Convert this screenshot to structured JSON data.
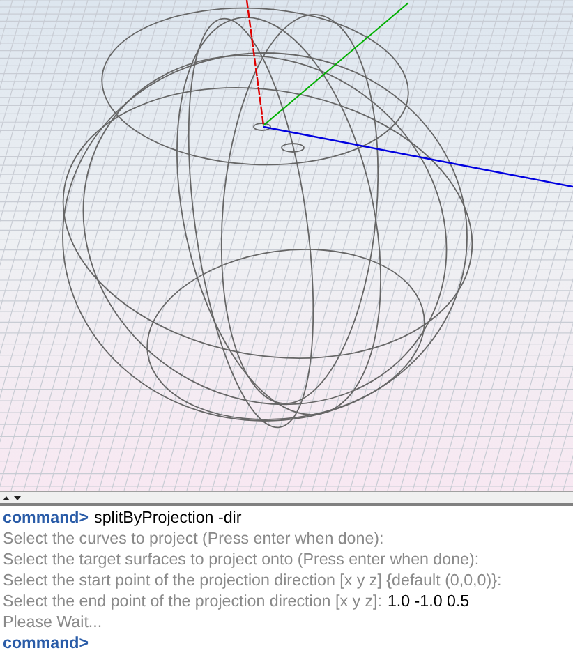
{
  "viewport": {
    "kind": "perspective"
  },
  "console": [
    {
      "kind": "command",
      "prompt": "command>",
      "text": "splitByProjection -dir"
    },
    {
      "kind": "output",
      "text": "Select the curves to project (Press enter when done):"
    },
    {
      "kind": "output",
      "text": "Select the target surfaces to project onto (Press enter when done):"
    },
    {
      "kind": "output",
      "text": "Select the start point of the projection direction [x y z] {default (0,0,0)}:"
    },
    {
      "kind": "output",
      "text": "Select the end point of the projection direction [x y z]:",
      "input": "1.0 -1.0 0.5"
    },
    {
      "kind": "output",
      "text": "Please Wait..."
    },
    {
      "kind": "command",
      "prompt": "command>"
    }
  ]
}
